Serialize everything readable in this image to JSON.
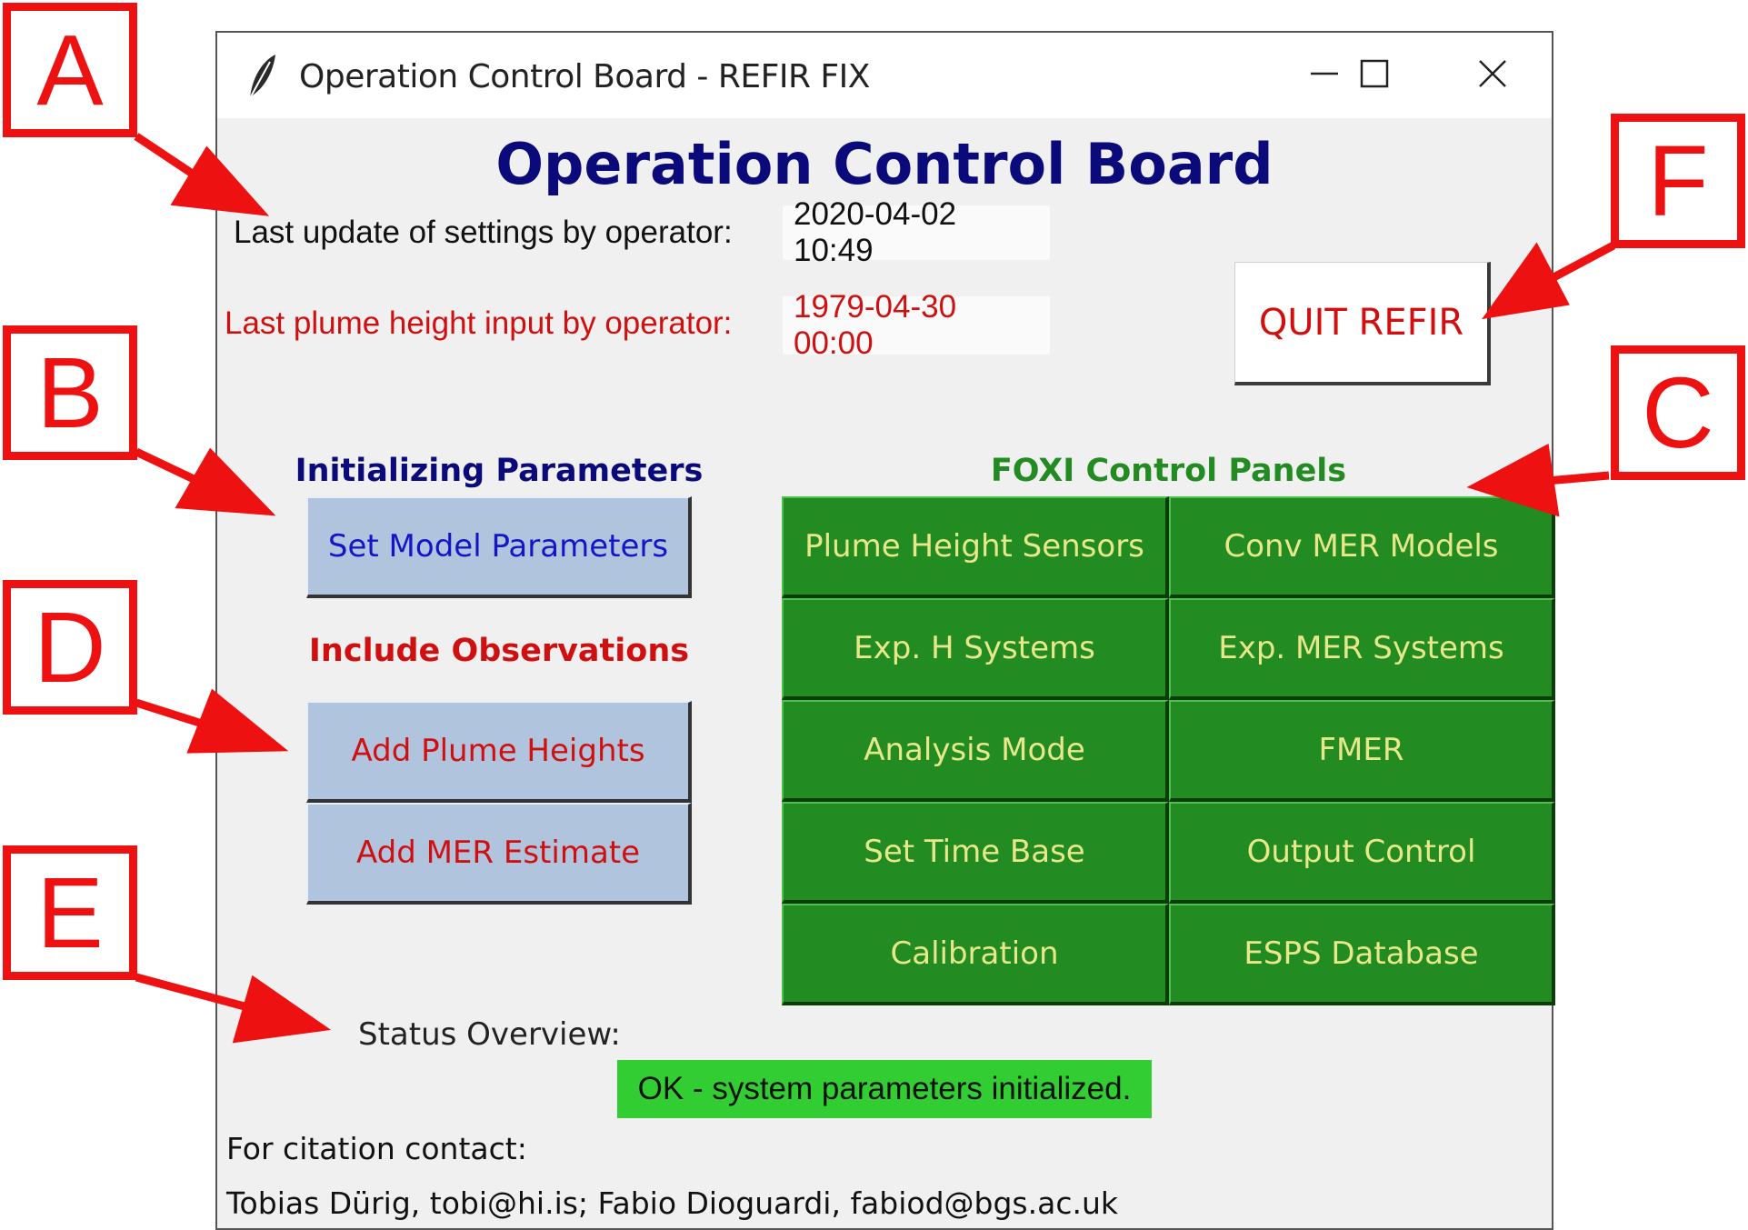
{
  "window": {
    "title": "Operation Control Board - REFIR FIX",
    "icon": "feather-icon",
    "controls": [
      "minimize-icon",
      "maximize-icon",
      "close-icon"
    ]
  },
  "header": {
    "title": "Operation Control Board"
  },
  "settings": {
    "last_update_label": "Last update of settings by operator:",
    "last_update_value": "2020-04-02 10:49",
    "last_plume_label": "Last plume height input by operator:",
    "last_plume_value": "1979-04-30 00:00"
  },
  "quit_button": "QUIT REFIR",
  "init_section": {
    "heading": "Initializing Parameters",
    "button": "Set Model Parameters"
  },
  "obs_section": {
    "heading": "Include Observations",
    "buttons": [
      "Add Plume Heights",
      "Add MER Estimate"
    ]
  },
  "foxi": {
    "heading": "FOXI Control Panels",
    "buttons": [
      "Plume Height Sensors",
      "Conv MER Models",
      "Exp. H Systems",
      "Exp. MER Systems",
      "Analysis Mode",
      "FMER",
      "Set Time Base",
      "Output Control",
      "Calibration",
      "ESPS Database"
    ]
  },
  "status": {
    "label": "Status Overview:",
    "value": "OK - system parameters initialized."
  },
  "citation": {
    "label": "For citation contact:",
    "contacts": "Tobias Dürig, tobi@hi.is; Fabio Dioguardi, fabiod@bgs.ac.uk"
  },
  "callouts": [
    "A",
    "B",
    "C",
    "D",
    "E",
    "F"
  ],
  "colors": {
    "title_blue": "#0a0a7a",
    "warning_red": "#d01010",
    "green_button": "#228b22",
    "green_text": "#e8e88a",
    "blue_button": "#b0c4de",
    "status_green": "#32cd32",
    "callout_red": "#ee1111"
  }
}
